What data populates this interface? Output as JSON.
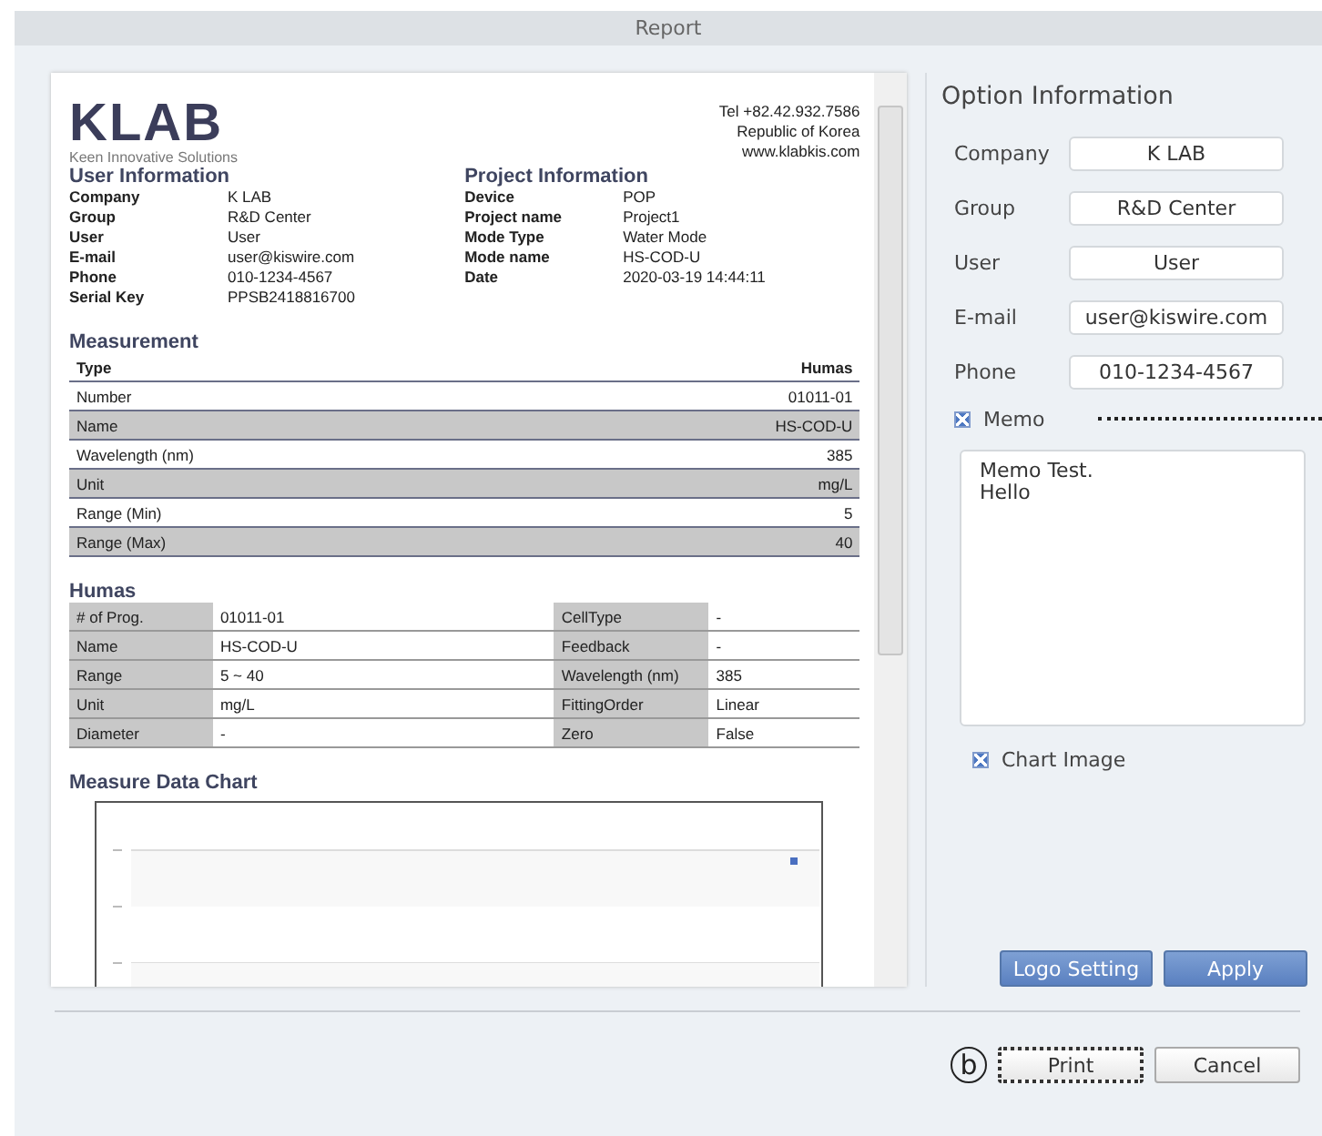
{
  "window": {
    "title": "Report"
  },
  "report": {
    "logo": "KLAB",
    "tagline": "Keen Innovative Solutions",
    "contact": [
      "Tel +82.42.932.7586",
      "Republic of Korea",
      "www.klabkis.com"
    ],
    "user_info": {
      "title": "User Information",
      "rows": [
        {
          "label": "Company",
          "value": "K LAB"
        },
        {
          "label": "Group",
          "value": "R&D Center"
        },
        {
          "label": "User",
          "value": "User"
        },
        {
          "label": "E-mail",
          "value": "user@kiswire.com"
        },
        {
          "label": "Phone",
          "value": "010-1234-4567"
        },
        {
          "label": "Serial Key",
          "value": "PPSB2418816700"
        }
      ]
    },
    "project_info": {
      "title": "Project Information",
      "rows": [
        {
          "label": "Device",
          "value": "POP"
        },
        {
          "label": "Project name",
          "value": "Project1"
        },
        {
          "label": "Mode Type",
          "value": "Water Mode"
        },
        {
          "label": "Mode name",
          "value": "HS-COD-U"
        },
        {
          "label": "Date",
          "value": "2020-03-19 14:44:11"
        }
      ]
    },
    "measurement": {
      "title": "Measurement",
      "header": [
        "Type",
        "Humas"
      ],
      "rows": [
        {
          "label": "Number",
          "value": "01011-01"
        },
        {
          "label": "Name",
          "value": "HS-COD-U"
        },
        {
          "label": "Wavelength (nm)",
          "value": "385"
        },
        {
          "label": "Unit",
          "value": "mg/L"
        },
        {
          "label": "Range (Min)",
          "value": "5"
        },
        {
          "label": "Range (Max)",
          "value": "40"
        }
      ]
    },
    "humas": {
      "title": "Humas",
      "rows": [
        {
          "cells": [
            "# of Prog.",
            "01011-01",
            "CellType",
            "-"
          ]
        },
        {
          "cells": [
            "Name",
            "HS-COD-U",
            "Feedback",
            "-"
          ]
        },
        {
          "cells": [
            "Range",
            "5 ~ 40",
            "Wavelength (nm)",
            "385"
          ]
        },
        {
          "cells": [
            "Unit",
            "mg/L",
            "FittingOrder",
            "Linear"
          ]
        },
        {
          "cells": [
            "Diameter",
            "-",
            "Zero",
            "False"
          ]
        }
      ]
    },
    "chart": {
      "title": "Measure Data Chart"
    }
  },
  "options": {
    "title": "Option Information",
    "fields": [
      {
        "label": "Company",
        "value": "K LAB"
      },
      {
        "label": "Group",
        "value": "R&D Center"
      },
      {
        "label": "User",
        "value": "User"
      },
      {
        "label": "E-mail",
        "value": "user@kiswire.com"
      },
      {
        "label": "Phone",
        "value": "010-1234-4567"
      }
    ],
    "memo": {
      "label": "Memo",
      "checked": true,
      "text": "Memo Test.\nHello"
    },
    "chart_image": {
      "label": "Chart Image",
      "checked": true
    },
    "buttons": [
      "Logo Setting",
      "Apply"
    ]
  },
  "footer_buttons": [
    {
      "label": "Print",
      "focused": true
    },
    {
      "label": "Cancel",
      "focused": false
    }
  ],
  "callout": "b"
}
